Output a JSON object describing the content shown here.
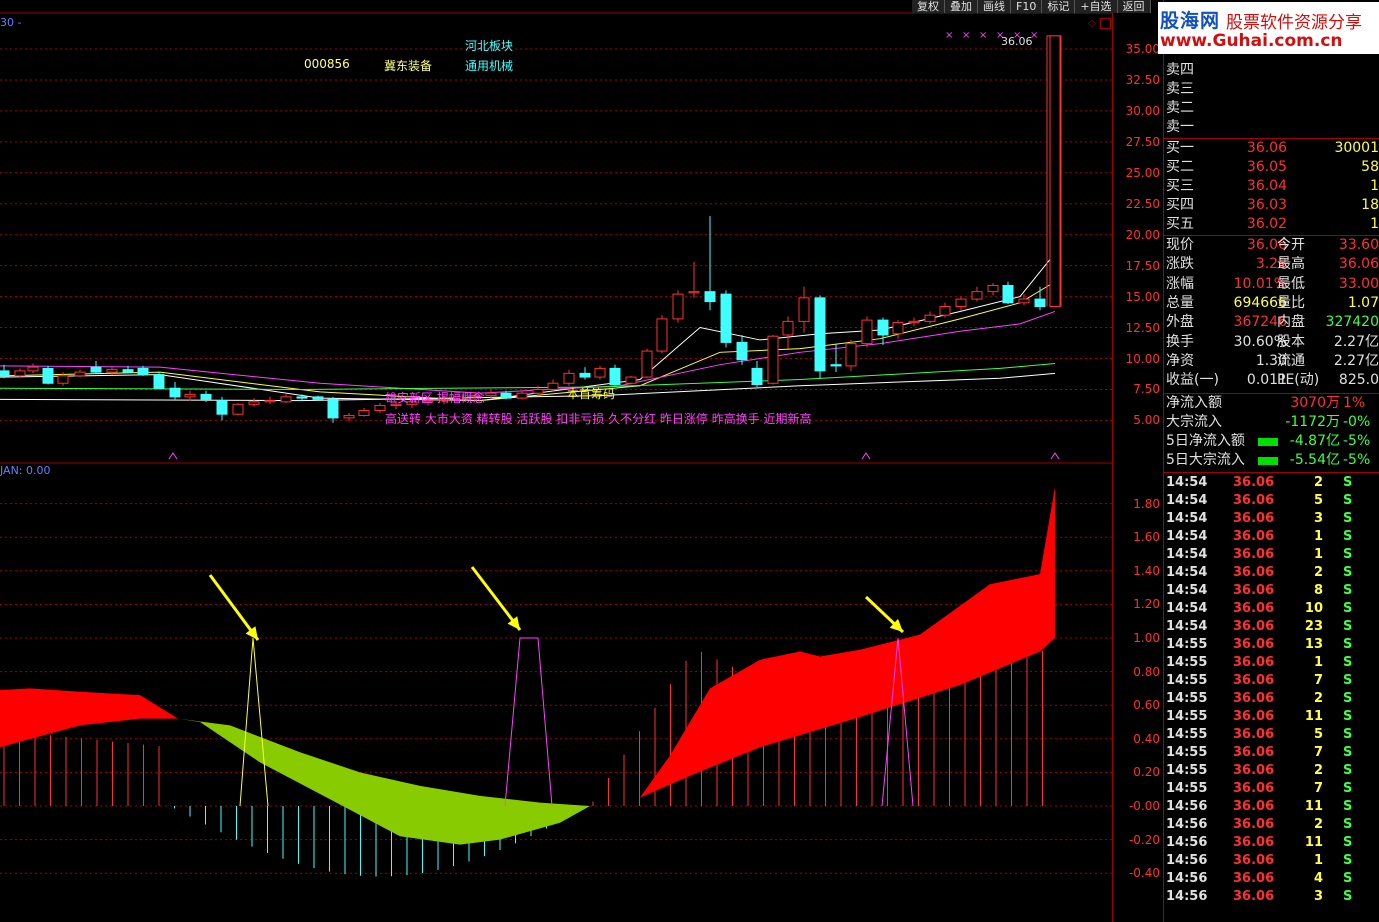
{
  "toolbar": {
    "items": [
      "复权",
      "叠加",
      "画线",
      "F10",
      "标记",
      "+自选",
      "返回"
    ]
  },
  "watermark": {
    "name": "股海网",
    "tagline": "股票软件资源分享",
    "url": "www.Guhai.com.cn"
  },
  "chart_header": {
    "period": "30 -",
    "indicator_label": "JAN: 0.00"
  },
  "stock": {
    "code": "000856",
    "name": "冀东装备",
    "sector": "河北板块",
    "industry": "通用机械"
  },
  "price_label": "36.06",
  "concepts": {
    "line1": "雄安新区 揭幅概念",
    "line2": "高送转 大市大资 精转股 活跃股 扣非亏损 久不分红 昨日涨停 昨高换手 近期新高",
    "chip_label": "本首筹码"
  },
  "y_main": [
    "35.00",
    "32.50",
    "30.00",
    "27.50",
    "25.00",
    "22.50",
    "20.00",
    "17.50",
    "15.00",
    "12.50",
    "10.00",
    "7.50",
    "5.00"
  ],
  "y_sub": [
    "1.80",
    "1.60",
    "1.40",
    "1.20",
    "1.00",
    "0.80",
    "0.60",
    "0.40",
    "0.20",
    "-0.00",
    "-0.20",
    "-0.40"
  ],
  "orderbook": {
    "asks": [
      {
        "label": "卖四"
      },
      {
        "label": "卖三"
      },
      {
        "label": "卖二"
      },
      {
        "label": "卖一"
      }
    ],
    "bids": [
      {
        "label": "买一",
        "price": "36.06",
        "vol": "30001"
      },
      {
        "label": "买二",
        "price": "36.05",
        "vol": "58"
      },
      {
        "label": "买三",
        "price": "36.04",
        "vol": "1"
      },
      {
        "label": "买四",
        "price": "36.03",
        "vol": "18"
      },
      {
        "label": "买五",
        "price": "36.02",
        "vol": "1"
      }
    ]
  },
  "quote": [
    {
      "k1": "现价",
      "v1": "36.06",
      "k2": "今开",
      "v2": "33.60",
      "c2": "#ff3030"
    },
    {
      "k1": "涨跌",
      "v1": "3.28",
      "k2": "最高",
      "v2": "36.06",
      "c2": "#ff3030"
    },
    {
      "k1": "涨幅",
      "v1": "10.01%",
      "k2": "最低",
      "v2": "33.00",
      "c2": "#ff3030"
    },
    {
      "k1": "总量",
      "v1": "694666",
      "k2": "量比",
      "v2": "1.07",
      "c2": "#ffff40"
    },
    {
      "k1": "外盘",
      "v1": "367246",
      "k2": "内盘",
      "v2": "327420",
      "c2": "#40ff40"
    },
    {
      "k1": "换手",
      "v1": "30.60%",
      "k2": "股本",
      "v2": "2.27亿",
      "c2": "#e0e0e0"
    },
    {
      "k1": "净资",
      "v1": "1.30",
      "k2": "流通",
      "v2": "2.27亿",
      "c2": "#e0e0e0"
    },
    {
      "k1": "收益(一)",
      "v1": "0.011",
      "k2": "PE(动)",
      "v2": "825.0",
      "c2": "#e0e0e0"
    }
  ],
  "flows": [
    {
      "label": "净流入额",
      "value": "3070万",
      "pct": "1%",
      "color": "#ff3030"
    },
    {
      "label": "大宗流入",
      "value": "-1172万",
      "pct": "-0%",
      "color": "#40ff40"
    },
    {
      "label": "5日净流入额",
      "value": "-4.87亿",
      "pct": "-5%",
      "color": "#40ff40"
    },
    {
      "label": "5日大宗流入",
      "value": "-5.54亿",
      "pct": "-5%",
      "color": "#40ff40"
    }
  ],
  "ticks": [
    {
      "t": "14:54",
      "p": "36.06",
      "v": "2",
      "s": "S"
    },
    {
      "t": "14:54",
      "p": "36.06",
      "v": "5",
      "s": "S"
    },
    {
      "t": "14:54",
      "p": "36.06",
      "v": "3",
      "s": "S"
    },
    {
      "t": "14:54",
      "p": "36.06",
      "v": "1",
      "s": "S"
    },
    {
      "t": "14:54",
      "p": "36.06",
      "v": "1",
      "s": "S"
    },
    {
      "t": "14:54",
      "p": "36.06",
      "v": "2",
      "s": "S"
    },
    {
      "t": "14:54",
      "p": "36.06",
      "v": "8",
      "s": "S"
    },
    {
      "t": "14:54",
      "p": "36.06",
      "v": "10",
      "s": "S"
    },
    {
      "t": "14:54",
      "p": "36.06",
      "v": "23",
      "s": "S"
    },
    {
      "t": "14:55",
      "p": "36.06",
      "v": "13",
      "s": "S"
    },
    {
      "t": "14:55",
      "p": "36.06",
      "v": "1",
      "s": "S"
    },
    {
      "t": "14:55",
      "p": "36.06",
      "v": "7",
      "s": "S"
    },
    {
      "t": "14:55",
      "p": "36.06",
      "v": "2",
      "s": "S"
    },
    {
      "t": "14:55",
      "p": "36.06",
      "v": "11",
      "s": "S"
    },
    {
      "t": "14:55",
      "p": "36.06",
      "v": "5",
      "s": "S"
    },
    {
      "t": "14:55",
      "p": "36.06",
      "v": "7",
      "s": "S"
    },
    {
      "t": "14:55",
      "p": "36.06",
      "v": "2",
      "s": "S"
    },
    {
      "t": "14:55",
      "p": "36.06",
      "v": "7",
      "s": "S"
    },
    {
      "t": "14:56",
      "p": "36.06",
      "v": "11",
      "s": "S"
    },
    {
      "t": "14:56",
      "p": "36.06",
      "v": "2",
      "s": "S"
    },
    {
      "t": "14:56",
      "p": "36.06",
      "v": "11",
      "s": "S"
    },
    {
      "t": "14:56",
      "p": "36.06",
      "v": "1",
      "s": "S"
    },
    {
      "t": "14:56",
      "p": "36.06",
      "v": "4",
      "s": "S"
    },
    {
      "t": "14:56",
      "p": "36.06",
      "v": "3",
      "s": "S"
    }
  ],
  "colors": {
    "up": "#ff3030",
    "down": "#40ffff",
    "grid": "#a00000",
    "ma5": "#ffffff",
    "ma10": "#ffff40",
    "ma20": "#ff40ff",
    "ma60": "#40ff40",
    "fill_up": "#ff0000",
    "fill_down": "#88cc00"
  }
}
